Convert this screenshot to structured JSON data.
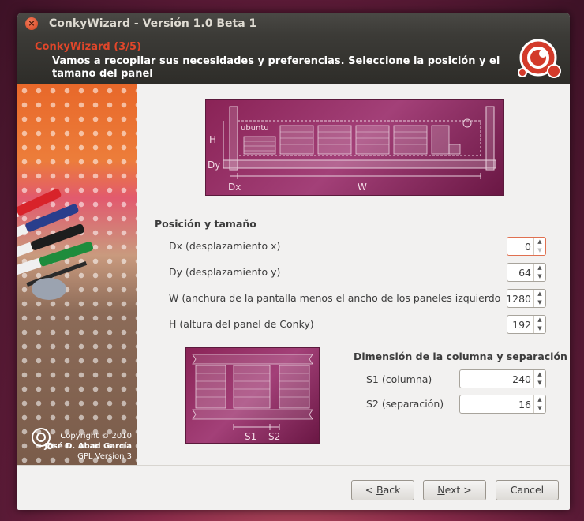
{
  "window": {
    "title": "ConkyWizard - Versión 1.0 Beta 1",
    "close_glyph": "×"
  },
  "header": {
    "step": "ConkyWizard (3/5)",
    "description": "Vamos a recopilar sus necesidades y preferencias. Seleccione la posición y el tamaño del panel"
  },
  "sidebar": {
    "copyright": "Copyright © 2010",
    "author": "José D. Abad García",
    "license": "GPL Version 3"
  },
  "preview_top": {
    "label_h": "H",
    "label_dy": "Dy",
    "label_dx": "Dx",
    "label_w": "W",
    "brand": "ubuntu"
  },
  "position_section": {
    "title": "Posición y tamaño",
    "fields": [
      {
        "label": "Dx (desplazamiento x)",
        "value": "0"
      },
      {
        "label": "Dy (desplazamiento y)",
        "value": "64"
      },
      {
        "label": "W (anchura de la pantalla menos el ancho de los paneles izquierdo y de",
        "value": "1280"
      },
      {
        "label": "H (altura del panel de Conky)",
        "value": "192"
      }
    ]
  },
  "column_section": {
    "title": "Dimensión de la columna y separación",
    "fields": [
      {
        "label": "S1 (columna)",
        "value": "240"
      },
      {
        "label": "S2 (separación)",
        "value": "16"
      }
    ]
  },
  "preview_bottom": {
    "label_s1": "S1",
    "label_s2": "S2"
  },
  "footer": {
    "back_prefix": "< ",
    "back_key": "B",
    "back_rest": "ack",
    "next_key": "N",
    "next_rest": "ext >",
    "cancel": "Cancel"
  },
  "icons": {
    "spin_up": "▲",
    "spin_down": "▼"
  },
  "colors": {
    "accent": "#e0462a",
    "preview_bg": "#8a2356"
  }
}
